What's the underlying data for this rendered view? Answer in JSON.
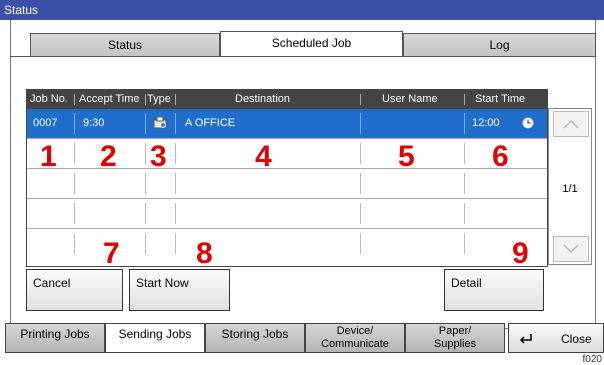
{
  "title": "Status",
  "tabs": [
    {
      "label": "Status"
    },
    {
      "label": "Scheduled Job",
      "active": true
    },
    {
      "label": "Log"
    }
  ],
  "table": {
    "headers": [
      "Job No.",
      "Accept Time",
      "Type",
      "Destination",
      "User Name",
      "Start Time"
    ],
    "rows": [
      {
        "job_no": "0007",
        "accept_time": "9:30",
        "type_icon": "fax-icon",
        "destination": "A OFFICE",
        "user_name": "",
        "start_time": "12:00",
        "time_icon": "clock-icon",
        "selected": true
      }
    ]
  },
  "callouts": [
    "1",
    "2",
    "3",
    "4",
    "5",
    "6",
    "7",
    "8",
    "9"
  ],
  "scroll": {
    "up_icon": "chevron-up-icon",
    "down_icon": "chevron-down-icon",
    "page": "1/1"
  },
  "buttons": {
    "cancel": "Cancel",
    "start_now": "Start Now",
    "detail": "Detail"
  },
  "bottom_tabs": [
    {
      "label": "Printing Jobs"
    },
    {
      "label": "Sending Jobs",
      "active": true
    },
    {
      "label": "Storing Jobs"
    },
    {
      "label": "Device/\nCommunicate"
    },
    {
      "label": "Paper/\nSupplies"
    }
  ],
  "close": {
    "label": "Close",
    "icon": "return-arrow-icon"
  },
  "figure_code": "f020"
}
